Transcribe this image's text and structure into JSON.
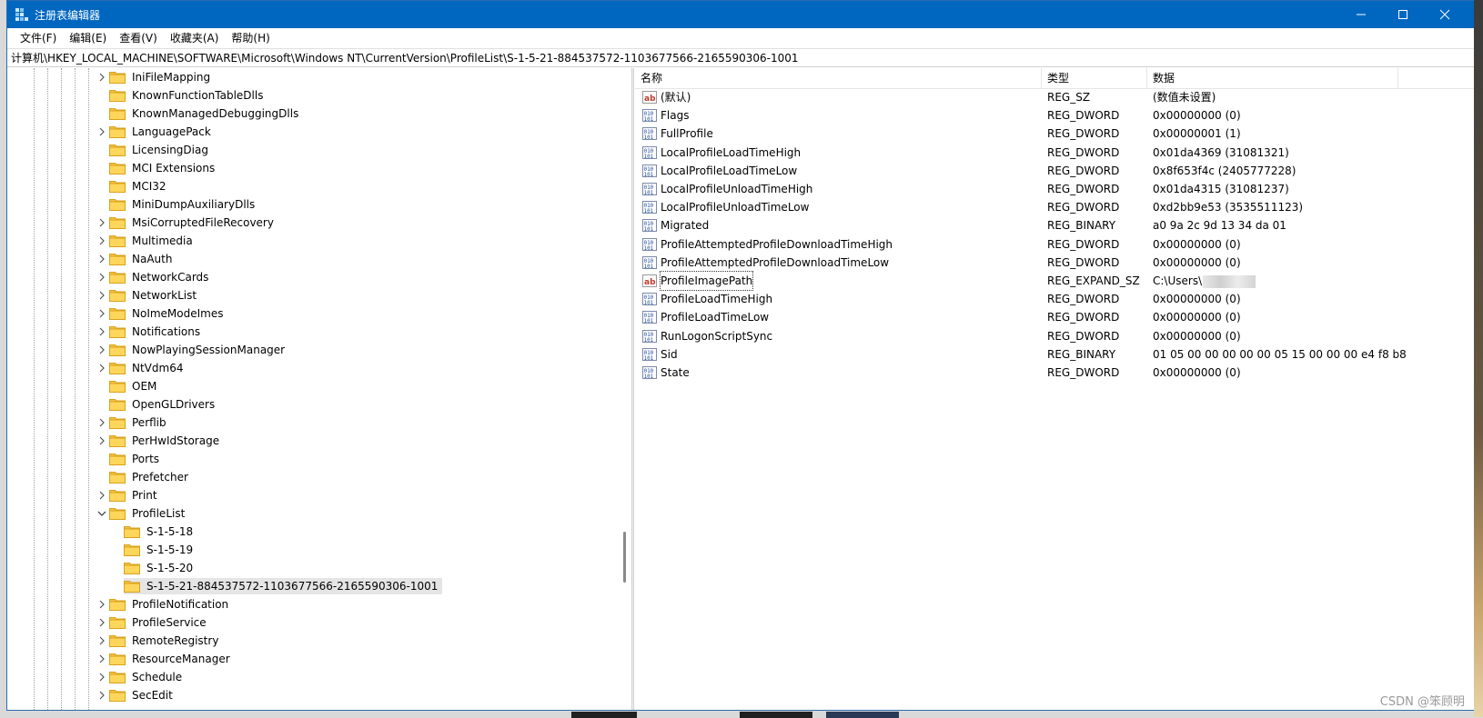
{
  "window": {
    "title": "注册表编辑器",
    "accent": "#0067c0"
  },
  "menu": [
    "文件(F)",
    "编辑(E)",
    "查看(V)",
    "收藏夹(A)",
    "帮助(H)"
  ],
  "address": "计算机\\HKEY_LOCAL_MACHINE\\SOFTWARE\\Microsoft\\Windows NT\\CurrentVersion\\ProfileList\\S-1-5-21-884537572-1103677566-2165590306-1001",
  "tree": {
    "items": [
      {
        "label": "IniFileMapping",
        "expander": "collapsed",
        "level": 0
      },
      {
        "label": "KnownFunctionTableDlls",
        "expander": "none",
        "level": 0
      },
      {
        "label": "KnownManagedDebuggingDlls",
        "expander": "none",
        "level": 0
      },
      {
        "label": "LanguagePack",
        "expander": "collapsed",
        "level": 0
      },
      {
        "label": "LicensingDiag",
        "expander": "none",
        "level": 0
      },
      {
        "label": "MCI Extensions",
        "expander": "none",
        "level": 0
      },
      {
        "label": "MCI32",
        "expander": "none",
        "level": 0
      },
      {
        "label": "MiniDumpAuxiliaryDlls",
        "expander": "none",
        "level": 0
      },
      {
        "label": "MsiCorruptedFileRecovery",
        "expander": "collapsed",
        "level": 0
      },
      {
        "label": "Multimedia",
        "expander": "collapsed",
        "level": 0
      },
      {
        "label": "NaAuth",
        "expander": "collapsed",
        "level": 0
      },
      {
        "label": "NetworkCards",
        "expander": "collapsed",
        "level": 0
      },
      {
        "label": "NetworkList",
        "expander": "collapsed",
        "level": 0
      },
      {
        "label": "NoImeModeImes",
        "expander": "collapsed",
        "level": 0
      },
      {
        "label": "Notifications",
        "expander": "collapsed",
        "level": 0
      },
      {
        "label": "NowPlayingSessionManager",
        "expander": "collapsed",
        "level": 0
      },
      {
        "label": "NtVdm64",
        "expander": "collapsed",
        "level": 0
      },
      {
        "label": "OEM",
        "expander": "none",
        "level": 0
      },
      {
        "label": "OpenGLDrivers",
        "expander": "none",
        "level": 0
      },
      {
        "label": "Perflib",
        "expander": "collapsed",
        "level": 0
      },
      {
        "label": "PerHwIdStorage",
        "expander": "collapsed",
        "level": 0
      },
      {
        "label": "Ports",
        "expander": "none",
        "level": 0
      },
      {
        "label": "Prefetcher",
        "expander": "none",
        "level": 0
      },
      {
        "label": "Print",
        "expander": "collapsed",
        "level": 0
      },
      {
        "label": "ProfileList",
        "expander": "expanded",
        "level": 0
      },
      {
        "label": "S-1-5-18",
        "expander": "none",
        "level": 1
      },
      {
        "label": "S-1-5-19",
        "expander": "none",
        "level": 1
      },
      {
        "label": "S-1-5-20",
        "expander": "none",
        "level": 1
      },
      {
        "label": "S-1-5-21-884537572-1103677566-2165590306-1001",
        "expander": "none",
        "level": 1,
        "selected": true
      },
      {
        "label": "ProfileNotification",
        "expander": "collapsed",
        "level": 0
      },
      {
        "label": "ProfileService",
        "expander": "collapsed",
        "level": 0
      },
      {
        "label": "RemoteRegistry",
        "expander": "collapsed",
        "level": 0
      },
      {
        "label": "ResourceManager",
        "expander": "collapsed",
        "level": 0
      },
      {
        "label": "Schedule",
        "expander": "collapsed",
        "level": 0
      },
      {
        "label": "SecEdit",
        "expander": "collapsed",
        "level": 0
      }
    ]
  },
  "list": {
    "columns": [
      "名称",
      "类型",
      "数据"
    ],
    "rows": [
      {
        "icon": "string-value-icon",
        "name": "(默认)",
        "type": "REG_SZ",
        "data": "(数值未设置)"
      },
      {
        "icon": "binary-value-icon",
        "name": "Flags",
        "type": "REG_DWORD",
        "data": "0x00000000 (0)"
      },
      {
        "icon": "binary-value-icon",
        "name": "FullProfile",
        "type": "REG_DWORD",
        "data": "0x00000001 (1)"
      },
      {
        "icon": "binary-value-icon",
        "name": "LocalProfileLoadTimeHigh",
        "type": "REG_DWORD",
        "data": "0x01da4369 (31081321)"
      },
      {
        "icon": "binary-value-icon",
        "name": "LocalProfileLoadTimeLow",
        "type": "REG_DWORD",
        "data": "0x8f653f4c (2405777228)"
      },
      {
        "icon": "binary-value-icon",
        "name": "LocalProfileUnloadTimeHigh",
        "type": "REG_DWORD",
        "data": "0x01da4315 (31081237)"
      },
      {
        "icon": "binary-value-icon",
        "name": "LocalProfileUnloadTimeLow",
        "type": "REG_DWORD",
        "data": "0xd2bb9e53 (3535511123)"
      },
      {
        "icon": "binary-value-icon",
        "name": "Migrated",
        "type": "REG_BINARY",
        "data": "a0 9a 2c 9d 13 34 da 01"
      },
      {
        "icon": "binary-value-icon",
        "name": "ProfileAttemptedProfileDownloadTimeHigh",
        "type": "REG_DWORD",
        "data": "0x00000000 (0)"
      },
      {
        "icon": "binary-value-icon",
        "name": "ProfileAttemptedProfileDownloadTimeLow",
        "type": "REG_DWORD",
        "data": "0x00000000 (0)"
      },
      {
        "icon": "string-value-icon",
        "name": "ProfileImagePath",
        "type": "REG_EXPAND_SZ",
        "data": "C:\\Users\\",
        "focused": true,
        "redacted": true
      },
      {
        "icon": "binary-value-icon",
        "name": "ProfileLoadTimeHigh",
        "type": "REG_DWORD",
        "data": "0x00000000 (0)"
      },
      {
        "icon": "binary-value-icon",
        "name": "ProfileLoadTimeLow",
        "type": "REG_DWORD",
        "data": "0x00000000 (0)"
      },
      {
        "icon": "binary-value-icon",
        "name": "RunLogonScriptSync",
        "type": "REG_DWORD",
        "data": "0x00000000 (0)"
      },
      {
        "icon": "binary-value-icon",
        "name": "Sid",
        "type": "REG_BINARY",
        "data": "01 05 00 00 00 00 00 05 15 00 00 00 e4 f8 b8..."
      },
      {
        "icon": "binary-value-icon",
        "name": "State",
        "type": "REG_DWORD",
        "data": "0x00000000 (0)"
      }
    ]
  },
  "watermark": "CSDN @笨顾明"
}
